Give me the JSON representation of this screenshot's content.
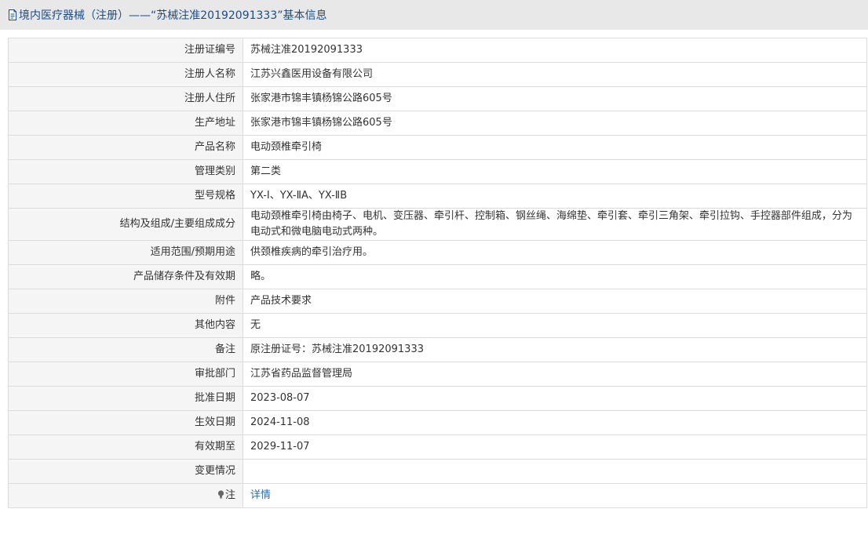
{
  "header": {
    "title": "境内医疗器械（注册）——“苏械注准20192091333”基本信息"
  },
  "rows": [
    {
      "label": "注册证编号",
      "value": "苏械注准20192091333"
    },
    {
      "label": "注册人名称",
      "value": "江苏兴鑫医用设备有限公司"
    },
    {
      "label": "注册人住所",
      "value": "张家港市锦丰镇杨锦公路605号"
    },
    {
      "label": "生产地址",
      "value": "张家港市锦丰镇杨锦公路605号"
    },
    {
      "label": "产品名称",
      "value": "电动颈椎牵引椅"
    },
    {
      "label": "管理类别",
      "value": "第二类"
    },
    {
      "label": "型号规格",
      "value": "YX-Ⅰ、YX-ⅡA、YX-ⅡB"
    },
    {
      "label": "结构及组成/主要组成成分",
      "value": "电动颈椎牵引椅由椅子、电机、变压器、牵引杆、控制箱、钢丝绳、海绵垫、牵引套、牵引三角架、牵引拉钩、手控器部件组成，分为电动式和微电脑电动式两种。"
    },
    {
      "label": "适用范围/预期用途",
      "value": "供颈椎疾病的牵引治疗用。"
    },
    {
      "label": "产品储存条件及有效期",
      "value": "略。"
    },
    {
      "label": "附件",
      "value": "产品技术要求"
    },
    {
      "label": "其他内容",
      "value": "无"
    },
    {
      "label": "备注",
      "value": "原注册证号：苏械注准20192091333"
    },
    {
      "label": "审批部门",
      "value": "江苏省药品监督管理局"
    },
    {
      "label": "批准日期",
      "value": "2023-08-07"
    },
    {
      "label": "生效日期",
      "value": "2024-11-08"
    },
    {
      "label": "有效期至",
      "value": "2029-11-07"
    },
    {
      "label": "变更情况",
      "value": ""
    }
  ],
  "note": {
    "label": "注",
    "link_text": "详情"
  },
  "colors": {
    "header_bg": "#e8e8e8",
    "title_text": "#1a4d8c",
    "label_bg": "#f5f5f5",
    "border": "#dcdcdc",
    "link": "#2a6ebb"
  },
  "icons": {
    "header": "document-icon",
    "note": "lightbulb-icon"
  }
}
